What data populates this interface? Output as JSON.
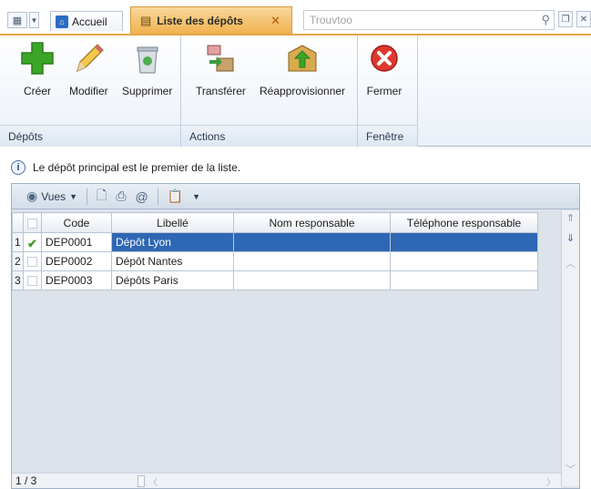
{
  "tabbar": {
    "home_tab": "Accueil",
    "active_tab": "Liste des dépôts",
    "search_placeholder": "Trouvtoo"
  },
  "ribbon": {
    "groups": [
      {
        "label": "Dépôts",
        "buttons": [
          "Créer",
          "Modifier",
          "Supprimer"
        ]
      },
      {
        "label": "Actions",
        "buttons": [
          "Transférer",
          "Réapprovisionner"
        ]
      },
      {
        "label": "Fenêtre",
        "buttons": [
          "Fermer"
        ]
      }
    ]
  },
  "info_text": "Le dépôt principal est le premier de la liste.",
  "grid_toolbar": {
    "views_label": "Vues"
  },
  "table": {
    "columns": [
      "Code",
      "Libellé",
      "Nom responsable",
      "Téléphone responsable"
    ],
    "rows": [
      {
        "num": "1",
        "checked": true,
        "code": "DEP0001",
        "libelle": "Dépôt Lyon",
        "nom": "",
        "tel": ""
      },
      {
        "num": "2",
        "checked": false,
        "code": "DEP0002",
        "libelle": "Dépôt Nantes",
        "nom": "",
        "tel": ""
      },
      {
        "num": "3",
        "checked": false,
        "code": "DEP0003",
        "libelle": "Dépôts Paris",
        "nom": "",
        "tel": ""
      }
    ]
  },
  "status": {
    "page": "1 / 3"
  },
  "colors": {
    "active_tab": "#f1b24f",
    "selection": "#2e67b5",
    "accent_border": "#e3a548"
  }
}
